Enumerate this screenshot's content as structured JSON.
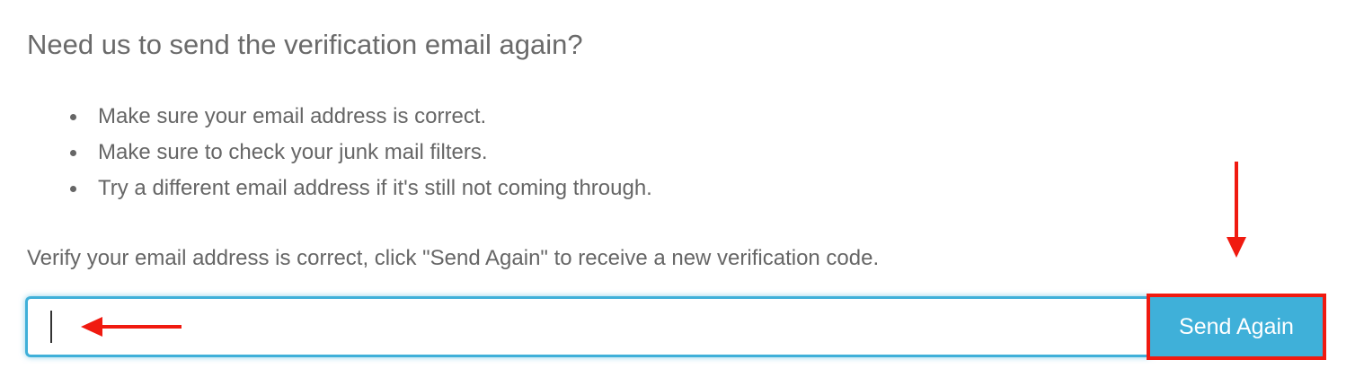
{
  "heading": "Need us to send the verification email again?",
  "tips": [
    "Make sure your email address is correct.",
    "Make sure to check your junk mail filters.",
    "Try a different email address if it's still not coming through."
  ],
  "instruction": "Verify your email address is correct, click \"Send Again\" to receive a new verification code.",
  "email_field": {
    "value": "",
    "placeholder": ""
  },
  "send_button": {
    "label": "Send Again"
  },
  "colors": {
    "accent": "#3fb0d9",
    "annotation": "#f01a10",
    "text": "#666666"
  },
  "annotations": {
    "arrow_down_icon": "arrow-down",
    "arrow_left_icon": "arrow-left"
  }
}
